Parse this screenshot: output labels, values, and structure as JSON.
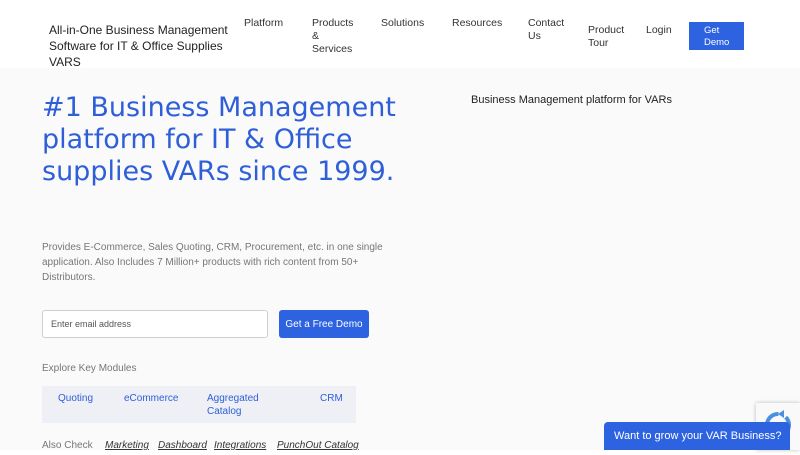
{
  "header": {
    "brand": "All-in-One Business Management Software for IT & Office Supplies VARS",
    "nav": {
      "platform": "Platform",
      "products_services": "Products & Services",
      "solutions": "Solutions",
      "resources": "Resources",
      "contact_us": "Contact Us",
      "product_tour": "Product Tour",
      "login": "Login",
      "get_demo": "Get Demo"
    }
  },
  "hero": {
    "title": "#1 Business Management platform for IT & Office supplies VARs since 1999.",
    "description": "Provides E-Commerce, Sales Quoting, CRM, Procurement, etc. in one single application. Also Includes 7 Million+ products with rich content from 50+ Distributors.",
    "email_placeholder": "Enter email address",
    "cta_label": "Get a Free Demo",
    "right_caption": "Business Management platform for VARs"
  },
  "modules": {
    "label": "Explore Key Modules",
    "items": [
      "Quoting",
      "eCommerce",
      "Aggregated Catalog",
      "CRM"
    ]
  },
  "also_check": {
    "label": "Also Check",
    "links": [
      "Marketing",
      "Dashboard",
      "Integrations",
      "PunchOut Catalog"
    ]
  },
  "chat": {
    "label": "Want to grow your VAR Business?"
  },
  "colors": {
    "accent": "#2d62e0",
    "title_blue": "#2e5fd8",
    "module_bg": "#eef0f5"
  }
}
